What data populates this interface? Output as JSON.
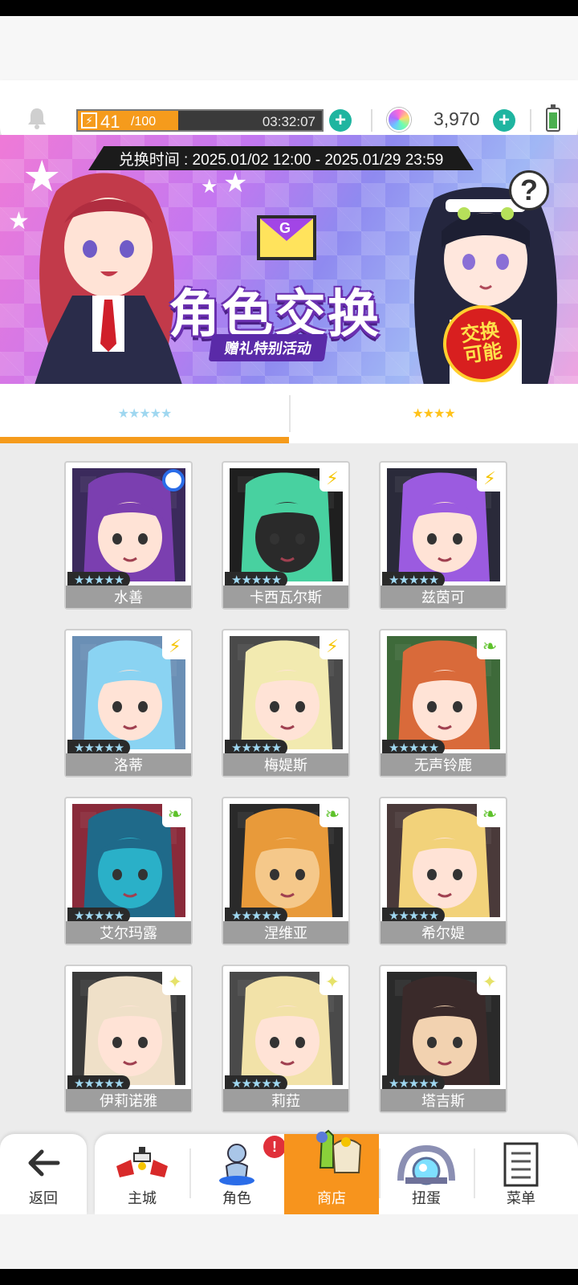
{
  "topbar": {
    "stamina_current": "41",
    "stamina_max": "/100",
    "stamina_fraction": 0.41,
    "timer": "03:32:07",
    "gem_count": "3,970",
    "icons": {
      "bell": "bell-icon",
      "bolt": "lightning-icon",
      "gem": "rainbow-gem-icon",
      "battery": "battery-icon"
    }
  },
  "banner": {
    "exchange_time": "兑换时间 : 2025.01/02 12:00 - 2025.01/29 23:59",
    "title": "角色交换",
    "subtitle": "赠礼特别活动",
    "badge": "交换\n可能",
    "envelope_letter": "G",
    "help": "?"
  },
  "tabs": [
    {
      "label": "★★★★★",
      "rarity": 5,
      "active": true
    },
    {
      "label": "★★★★",
      "rarity": 4,
      "active": false
    }
  ],
  "characters": [
    {
      "name": "水善",
      "stars": "★★★★★",
      "attribute": "water"
    },
    {
      "name": "卡西瓦尔斯",
      "stars": "★★★★★",
      "attribute": "electric"
    },
    {
      "name": "兹茵可",
      "stars": "★★★★★",
      "attribute": "electric"
    },
    {
      "name": "洛蒂",
      "stars": "★★★★★",
      "attribute": "electric"
    },
    {
      "name": "梅媞斯",
      "stars": "★★★★★",
      "attribute": "electric"
    },
    {
      "name": "无声铃鹿",
      "stars": "★★★★★",
      "attribute": "nature"
    },
    {
      "name": "艾尔玛露",
      "stars": "★★★★★",
      "attribute": "nature"
    },
    {
      "name": "涅维亚",
      "stars": "★★★★★",
      "attribute": "nature"
    },
    {
      "name": "希尔媞",
      "stars": "★★★★★",
      "attribute": "nature"
    },
    {
      "name": "伊莉诺雅",
      "stars": "★★★★★",
      "attribute": "light"
    },
    {
      "name": "莉菈",
      "stars": "★★★★★",
      "attribute": "light"
    },
    {
      "name": "塔吉斯",
      "stars": "★★★★★",
      "attribute": "light"
    }
  ],
  "nav": {
    "back": "返回",
    "items": [
      {
        "label": "主城",
        "icon": "town-icon"
      },
      {
        "label": "角色",
        "icon": "character-icon",
        "alert": "!"
      },
      {
        "label": "商店",
        "icon": "shop-icon",
        "active": true
      },
      {
        "label": "扭蛋",
        "icon": "gacha-icon"
      },
      {
        "label": "菜单",
        "icon": "menu-icon"
      }
    ]
  },
  "colors": {
    "accent": "#f7941d",
    "teal": "#1fb5a0",
    "card_name_bg": "#9e9e9e"
  }
}
